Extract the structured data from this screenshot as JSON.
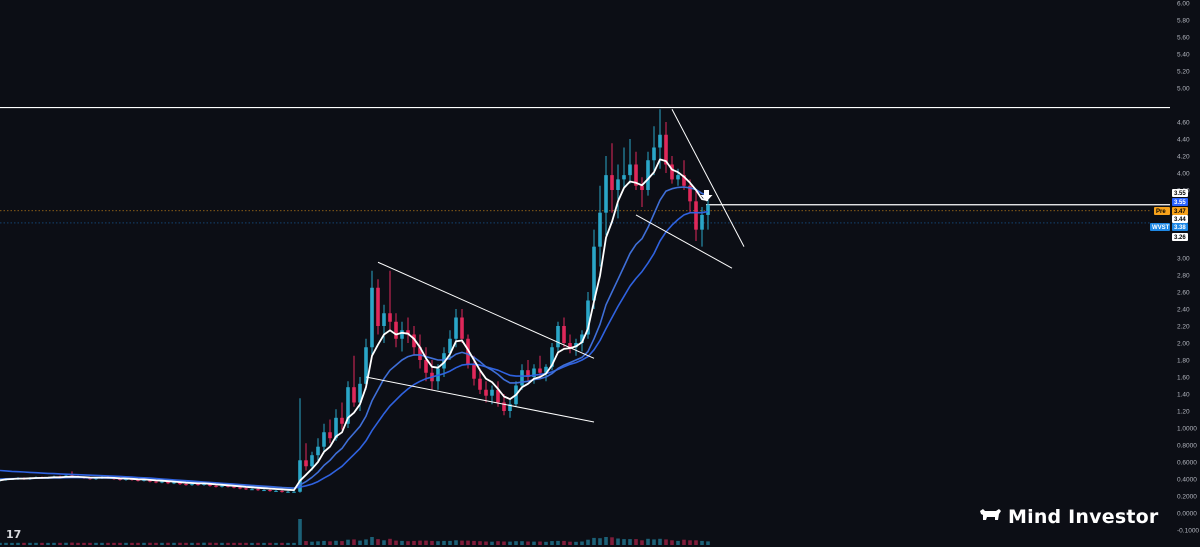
{
  "chart_data": {
    "type": "candlestick",
    "title": "",
    "xlabel": "",
    "ylabel": "",
    "ylim": [
      -0.1,
      6.0
    ],
    "y_scale": "mixed",
    "grid": false,
    "y_ticks": [
      {
        "value": -0.1,
        "label": "-0.1000"
      },
      {
        "value": 0.0,
        "label": "0.0000"
      },
      {
        "value": 0.2,
        "label": "0.2000"
      },
      {
        "value": 0.4,
        "label": "0.4000"
      },
      {
        "value": 0.6,
        "label": "0.6000"
      },
      {
        "value": 0.8,
        "label": "0.8000"
      },
      {
        "value": 1.0,
        "label": "1.0000"
      },
      {
        "value": 1.2,
        "label": "1.20"
      },
      {
        "value": 1.4,
        "label": "1.40"
      },
      {
        "value": 1.6,
        "label": "1.60"
      },
      {
        "value": 1.8,
        "label": "1.80"
      },
      {
        "value": 2.0,
        "label": "2.00"
      },
      {
        "value": 2.2,
        "label": "2.20"
      },
      {
        "value": 2.4,
        "label": "2.40"
      },
      {
        "value": 2.6,
        "label": "2.60"
      },
      {
        "value": 2.8,
        "label": "2.80"
      },
      {
        "value": 3.0,
        "label": "3.00"
      },
      {
        "value": 3.6,
        "label": "3.60"
      },
      {
        "value": 4.0,
        "label": "4.00"
      },
      {
        "value": 4.2,
        "label": "4.20"
      },
      {
        "value": 4.4,
        "label": "4.40"
      },
      {
        "value": 4.6,
        "label": "4.60"
      },
      {
        "value": 5.0,
        "label": "5.00"
      },
      {
        "value": 5.2,
        "label": "5.20"
      },
      {
        "value": 5.4,
        "label": "5.40"
      },
      {
        "value": 5.6,
        "label": "5.60"
      },
      {
        "value": 5.8,
        "label": "5.80"
      },
      {
        "value": 6.0,
        "label": "6.00"
      }
    ],
    "candles": [
      [
        0.38,
        0.4,
        0.37,
        0.39
      ],
      [
        0.39,
        0.41,
        0.38,
        0.4
      ],
      [
        0.4,
        0.41,
        0.39,
        0.4
      ],
      [
        0.4,
        0.42,
        0.39,
        0.41
      ],
      [
        0.41,
        0.42,
        0.39,
        0.4
      ],
      [
        0.4,
        0.42,
        0.39,
        0.41
      ],
      [
        0.41,
        0.43,
        0.4,
        0.42
      ],
      [
        0.42,
        0.43,
        0.4,
        0.41
      ],
      [
        0.41,
        0.42,
        0.4,
        0.42
      ],
      [
        0.42,
        0.44,
        0.41,
        0.43
      ],
      [
        0.43,
        0.44,
        0.41,
        0.42
      ],
      [
        0.42,
        0.45,
        0.41,
        0.44
      ],
      [
        0.44,
        0.49,
        0.42,
        0.43
      ],
      [
        0.43,
        0.44,
        0.41,
        0.42
      ],
      [
        0.42,
        0.43,
        0.4,
        0.41
      ],
      [
        0.41,
        0.42,
        0.39,
        0.4
      ],
      [
        0.4,
        0.42,
        0.39,
        0.41
      ],
      [
        0.41,
        0.43,
        0.4,
        0.42
      ],
      [
        0.42,
        0.43,
        0.4,
        0.41
      ],
      [
        0.41,
        0.42,
        0.39,
        0.4
      ],
      [
        0.4,
        0.41,
        0.38,
        0.39
      ],
      [
        0.39,
        0.41,
        0.38,
        0.4
      ],
      [
        0.4,
        0.41,
        0.38,
        0.39
      ],
      [
        0.39,
        0.4,
        0.37,
        0.38
      ],
      [
        0.38,
        0.4,
        0.37,
        0.39
      ],
      [
        0.39,
        0.4,
        0.36,
        0.37
      ],
      [
        0.37,
        0.38,
        0.35,
        0.36
      ],
      [
        0.36,
        0.38,
        0.35,
        0.37
      ],
      [
        0.37,
        0.38,
        0.34,
        0.35
      ],
      [
        0.35,
        0.37,
        0.34,
        0.36
      ],
      [
        0.36,
        0.37,
        0.33,
        0.34
      ],
      [
        0.34,
        0.35,
        0.32,
        0.33
      ],
      [
        0.33,
        0.35,
        0.32,
        0.34
      ],
      [
        0.34,
        0.35,
        0.32,
        0.33
      ],
      [
        0.33,
        0.37,
        0.32,
        0.35
      ],
      [
        0.35,
        0.36,
        0.31,
        0.32
      ],
      [
        0.32,
        0.33,
        0.3,
        0.31
      ],
      [
        0.31,
        0.33,
        0.3,
        0.32
      ],
      [
        0.32,
        0.33,
        0.3,
        0.31
      ],
      [
        0.31,
        0.32,
        0.29,
        0.3
      ],
      [
        0.3,
        0.31,
        0.28,
        0.29
      ],
      [
        0.29,
        0.3,
        0.27,
        0.28
      ],
      [
        0.28,
        0.29,
        0.27,
        0.28
      ],
      [
        0.28,
        0.29,
        0.26,
        0.27
      ],
      [
        0.27,
        0.28,
        0.26,
        0.27
      ],
      [
        0.27,
        0.28,
        0.25,
        0.26
      ],
      [
        0.26,
        0.27,
        0.25,
        0.26
      ],
      [
        0.26,
        0.27,
        0.24,
        0.25
      ],
      [
        0.25,
        0.26,
        0.24,
        0.25
      ],
      [
        0.25,
        0.26,
        0.24,
        0.25
      ],
      [
        0.25,
        1.35,
        0.24,
        0.62
      ],
      [
        0.62,
        0.82,
        0.5,
        0.55
      ],
      [
        0.55,
        0.72,
        0.5,
        0.68
      ],
      [
        0.68,
        0.88,
        0.6,
        0.78
      ],
      [
        0.78,
        1.05,
        0.7,
        0.95
      ],
      [
        0.95,
        1.1,
        0.82,
        0.88
      ],
      [
        0.88,
        1.22,
        0.85,
        1.12
      ],
      [
        1.12,
        1.3,
        0.98,
        1.05
      ],
      [
        1.05,
        1.55,
        1.0,
        1.48
      ],
      [
        1.48,
        1.85,
        1.25,
        1.3
      ],
      [
        1.3,
        1.6,
        1.2,
        1.52
      ],
      [
        1.52,
        2.05,
        1.45,
        1.95
      ],
      [
        1.95,
        2.85,
        1.85,
        2.65
      ],
      [
        2.65,
        2.75,
        2.1,
        2.2
      ],
      [
        2.2,
        2.45,
        2.0,
        2.35
      ],
      [
        2.35,
        2.85,
        2.15,
        2.25
      ],
      [
        2.25,
        2.35,
        1.95,
        2.05
      ],
      [
        2.05,
        2.25,
        1.9,
        2.15
      ],
      [
        2.15,
        2.3,
        2.0,
        2.1
      ],
      [
        2.1,
        2.2,
        1.85,
        1.95
      ],
      [
        1.95,
        2.1,
        1.7,
        1.8
      ],
      [
        1.8,
        1.95,
        1.55,
        1.65
      ],
      [
        1.65,
        1.8,
        1.45,
        1.55
      ],
      [
        1.55,
        1.75,
        1.45,
        1.7
      ],
      [
        1.7,
        1.95,
        1.6,
        1.88
      ],
      [
        1.88,
        2.15,
        1.8,
        2.05
      ],
      [
        2.05,
        2.4,
        1.95,
        2.3
      ],
      [
        2.3,
        2.4,
        2.0,
        2.05
      ],
      [
        2.05,
        2.1,
        1.7,
        1.75
      ],
      [
        1.75,
        1.85,
        1.5,
        1.58
      ],
      [
        1.58,
        1.7,
        1.4,
        1.45
      ],
      [
        1.45,
        1.55,
        1.3,
        1.38
      ],
      [
        1.38,
        1.5,
        1.28,
        1.45
      ],
      [
        1.45,
        1.55,
        1.25,
        1.3
      ],
      [
        1.3,
        1.4,
        1.15,
        1.2
      ],
      [
        1.2,
        1.35,
        1.12,
        1.28
      ],
      [
        1.28,
        1.55,
        1.25,
        1.5
      ],
      [
        1.5,
        1.75,
        1.45,
        1.68
      ],
      [
        1.68,
        1.8,
        1.55,
        1.6
      ],
      [
        1.6,
        1.75,
        1.52,
        1.7
      ],
      [
        1.7,
        1.85,
        1.6,
        1.65
      ],
      [
        1.65,
        1.75,
        1.55,
        1.72
      ],
      [
        1.72,
        2.0,
        1.68,
        1.95
      ],
      [
        1.95,
        2.25,
        1.9,
        2.2
      ],
      [
        2.2,
        2.3,
        1.95,
        2.0
      ],
      [
        2.0,
        2.1,
        1.88,
        1.95
      ],
      [
        1.95,
        2.05,
        1.85,
        2.0
      ],
      [
        2.0,
        2.15,
        1.9,
        2.1
      ],
      [
        2.1,
        2.6,
        2.05,
        2.5
      ],
      [
        2.5,
        3.25,
        2.4,
        3.1
      ],
      [
        3.1,
        3.7,
        2.9,
        3.4
      ],
      [
        3.4,
        4.2,
        3.2,
        3.95
      ],
      [
        3.95,
        4.35,
        3.4,
        3.6
      ],
      [
        3.6,
        4.1,
        3.35,
        3.85
      ],
      [
        3.85,
        4.3,
        3.65,
        3.95
      ],
      [
        3.95,
        4.4,
        3.75,
        4.1
      ],
      [
        4.1,
        4.25,
        3.6,
        3.7
      ],
      [
        3.7,
        3.9,
        3.45,
        3.6
      ],
      [
        3.6,
        4.25,
        3.55,
        4.15
      ],
      [
        4.15,
        4.55,
        3.95,
        4.3
      ],
      [
        4.3,
        4.75,
        4.05,
        4.45
      ],
      [
        4.45,
        4.6,
        4.0,
        4.1
      ],
      [
        4.1,
        4.2,
        3.75,
        3.85
      ],
      [
        3.85,
        4.05,
        3.7,
        3.95
      ],
      [
        3.95,
        4.15,
        3.6,
        3.7
      ],
      [
        3.7,
        3.85,
        3.4,
        3.5
      ],
      [
        3.5,
        3.6,
        3.15,
        3.25
      ],
      [
        3.25,
        3.45,
        3.1,
        3.38
      ],
      [
        3.38,
        3.52,
        3.25,
        3.47
      ]
    ],
    "ema_fast": [
      0.385,
      0.395,
      0.4,
      0.405,
      0.405,
      0.408,
      0.412,
      0.413,
      0.415,
      0.42,
      0.42,
      0.425,
      0.427,
      0.425,
      0.422,
      0.418,
      0.416,
      0.417,
      0.416,
      0.413,
      0.408,
      0.406,
      0.402,
      0.397,
      0.395,
      0.39,
      0.384,
      0.38,
      0.374,
      0.37,
      0.364,
      0.357,
      0.353,
      0.348,
      0.348,
      0.343,
      0.336,
      0.332,
      0.326,
      0.32,
      0.314,
      0.307,
      0.302,
      0.296,
      0.292,
      0.287,
      0.282,
      0.278,
      0.273,
      0.27,
      0.38,
      0.45,
      0.52,
      0.6,
      0.72,
      0.78,
      0.9,
      0.95,
      1.12,
      1.18,
      1.28,
      1.48,
      1.85,
      1.98,
      2.1,
      2.15,
      2.1,
      2.12,
      2.11,
      2.05,
      1.95,
      1.82,
      1.72,
      1.71,
      1.77,
      1.87,
      2.02,
      2.03,
      1.92,
      1.8,
      1.68,
      1.58,
      1.54,
      1.46,
      1.37,
      1.34,
      1.39,
      1.48,
      1.52,
      1.58,
      1.6,
      1.64,
      1.74,
      1.89,
      1.93,
      1.94,
      1.96,
      2.01,
      2.17,
      2.49,
      2.79,
      3.18,
      3.32,
      3.5,
      3.65,
      3.8,
      3.77,
      3.71,
      3.86,
      4.01,
      4.16,
      4.14,
      4.04,
      4.01,
      3.91,
      3.77,
      3.6,
      3.52,
      3.51
    ],
    "ema_mid": [
      0.4,
      0.402,
      0.404,
      0.406,
      0.406,
      0.407,
      0.409,
      0.41,
      0.41,
      0.412,
      0.413,
      0.415,
      0.416,
      0.416,
      0.415,
      0.413,
      0.412,
      0.412,
      0.411,
      0.409,
      0.407,
      0.405,
      0.402,
      0.399,
      0.396,
      0.393,
      0.389,
      0.386,
      0.382,
      0.378,
      0.374,
      0.369,
      0.365,
      0.361,
      0.357,
      0.352,
      0.347,
      0.343,
      0.338,
      0.333,
      0.328,
      0.323,
      0.319,
      0.314,
      0.31,
      0.306,
      0.302,
      0.298,
      0.295,
      0.292,
      0.33,
      0.37,
      0.42,
      0.48,
      0.56,
      0.62,
      0.7,
      0.76,
      0.86,
      0.94,
      1.02,
      1.14,
      1.32,
      1.45,
      1.58,
      1.68,
      1.74,
      1.8,
      1.84,
      1.86,
      1.86,
      1.84,
      1.82,
      1.8,
      1.8,
      1.82,
      1.87,
      1.89,
      1.87,
      1.83,
      1.78,
      1.72,
      1.68,
      1.63,
      1.57,
      1.53,
      1.53,
      1.54,
      1.55,
      1.57,
      1.58,
      1.6,
      1.64,
      1.7,
      1.74,
      1.77,
      1.8,
      1.83,
      1.9,
      2.05,
      2.22,
      2.45,
      2.6,
      2.75,
      2.9,
      3.04,
      3.12,
      3.17,
      3.27,
      3.39,
      3.51,
      3.59,
      3.63,
      3.66,
      3.67,
      3.65,
      3.61,
      3.57,
      3.55
    ],
    "ema_slow": [
      0.5,
      0.495,
      0.49,
      0.486,
      0.482,
      0.478,
      0.474,
      0.47,
      0.466,
      0.463,
      0.46,
      0.457,
      0.454,
      0.451,
      0.448,
      0.445,
      0.442,
      0.439,
      0.436,
      0.433,
      0.43,
      0.426,
      0.422,
      0.418,
      0.414,
      0.41,
      0.405,
      0.4,
      0.395,
      0.39,
      0.385,
      0.38,
      0.375,
      0.37,
      0.365,
      0.36,
      0.355,
      0.35,
      0.345,
      0.34,
      0.335,
      0.33,
      0.325,
      0.32,
      0.315,
      0.31,
      0.305,
      0.3,
      0.296,
      0.292,
      0.305,
      0.32,
      0.34,
      0.37,
      0.41,
      0.45,
      0.5,
      0.55,
      0.62,
      0.69,
      0.76,
      0.85,
      0.97,
      1.07,
      1.17,
      1.26,
      1.33,
      1.4,
      1.46,
      1.51,
      1.55,
      1.58,
      1.6,
      1.62,
      1.64,
      1.67,
      1.71,
      1.74,
      1.75,
      1.75,
      1.74,
      1.72,
      1.7,
      1.68,
      1.65,
      1.62,
      1.61,
      1.61,
      1.61,
      1.62,
      1.63,
      1.64,
      1.66,
      1.69,
      1.72,
      1.75,
      1.77,
      1.8,
      1.84,
      1.92,
      2.03,
      2.17,
      2.3,
      2.43,
      2.55,
      2.67,
      2.76,
      2.84,
      2.94,
      3.04,
      3.15,
      3.23,
      3.29,
      3.34,
      3.38,
      3.4,
      3.4,
      3.4,
      3.41
    ],
    "trendlines": [
      {
        "x1": 63,
        "y1": 2.95,
        "x2": 99,
        "y2": 1.82
      },
      {
        "x1": 61,
        "y1": 1.6,
        "x2": 99,
        "y2": 1.07
      },
      {
        "x1": 112,
        "y1": 4.75,
        "x2": 124,
        "y2": 3.1
      },
      {
        "x1": 106,
        "y1": 3.38,
        "x2": 122,
        "y2": 2.88
      }
    ],
    "horizontal_levels": [
      {
        "value": 4.77,
        "label": "4.77",
        "color": "#ffffff"
      },
      {
        "value": 3.47,
        "label": "3.47",
        "color": "#ffffff"
      }
    ],
    "price_tags": [
      {
        "value": 3.58,
        "label": "3.55",
        "bg": "#ffffff",
        "fg": "#000000"
      },
      {
        "value": 3.55,
        "label": "3.55",
        "bg": "#2962ff",
        "fg": "#ffffff"
      },
      {
        "value": 3.47,
        "label": "3.47",
        "bg": "#f7a21b",
        "fg": "#000000",
        "prefix": "Pre"
      },
      {
        "value": 3.44,
        "label": "3.44",
        "bg": "#ffffff",
        "fg": "#000000"
      },
      {
        "value": 3.38,
        "label": "3.38",
        "bg": "#1e88e5",
        "fg": "#ffffff",
        "prefix": "WVST"
      },
      {
        "value": 3.26,
        "label": "3.26",
        "bg": "#ffffff",
        "fg": "#000000"
      }
    ],
    "colors": {
      "background": "#0c0e15",
      "up": "#2aa6c8",
      "down": "#e0285a",
      "ema_fast": "#ffffff",
      "ema_mid": "#3f6fd8",
      "ema_slow": "#2f62e0",
      "trendline": "#ffffff",
      "pre_line": "#f7a21b",
      "last_line": "#1e88e5"
    }
  },
  "brand": {
    "name": "Mind Investor",
    "icon": "bull-icon"
  },
  "platform_logo": {
    "text": "17",
    "icon": "tradingview-logo-icon"
  },
  "marker": {
    "icon": "down-arrow-icon"
  }
}
